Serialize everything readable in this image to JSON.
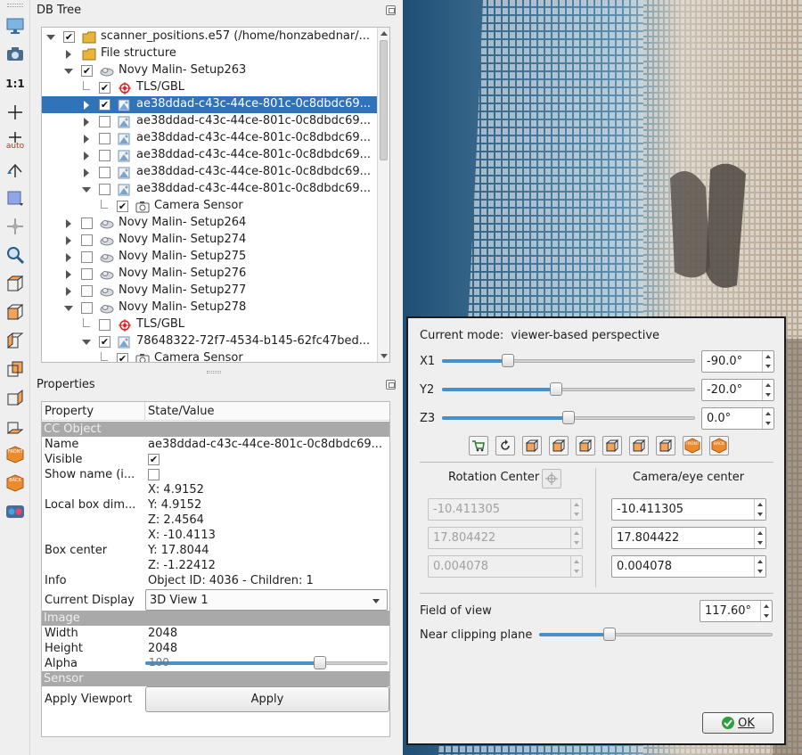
{
  "toolbar": {
    "icons": [
      "display-icon",
      "camera-icon",
      "one-to-one-icon",
      "pivot-icon",
      "auto-pivot-icon",
      "rotate-icon",
      "perspective-icon",
      "translate-icon",
      "zoom-icon",
      "view-top-icon",
      "view-front-icon",
      "view-left-icon",
      "view-back-icon",
      "view-right-icon",
      "view-bottom-icon",
      "view-front-iso-icon",
      "view-back-iso-icon",
      "stereo-glasses-icon"
    ],
    "ratio_label": "1:1",
    "auto_label": "auto",
    "front_label": "FRONT",
    "back_label": "BACK"
  },
  "db_tree": {
    "title": "DB Tree",
    "rows": [
      {
        "label": "scanner_positions.e57 (/home/honzabednar/...",
        "checked": true,
        "expander": "down",
        "icon": "folder-icon"
      },
      {
        "label": "File structure",
        "checked": null,
        "expander": "right",
        "icon": "folder-icon"
      },
      {
        "label": "Novy Malin- Setup263",
        "checked": true,
        "expander": "down",
        "icon": "cloud-icon"
      },
      {
        "label": "TLS/GBL",
        "checked": true,
        "expander": "none",
        "icon": "target-icon"
      },
      {
        "label": "ae38ddad-c43c-44ce-801c-0c8dbdc69...",
        "checked": true,
        "expander": "right",
        "icon": "image-icon",
        "selected": true
      },
      {
        "label": "ae38ddad-c43c-44ce-801c-0c8dbdc69...",
        "checked": false,
        "expander": "right",
        "icon": "image-icon"
      },
      {
        "label": "ae38ddad-c43c-44ce-801c-0c8dbdc69...",
        "checked": false,
        "expander": "right",
        "icon": "image-icon"
      },
      {
        "label": "ae38ddad-c43c-44ce-801c-0c8dbdc69...",
        "checked": false,
        "expander": "right",
        "icon": "image-icon"
      },
      {
        "label": "ae38ddad-c43c-44ce-801c-0c8dbdc69...",
        "checked": false,
        "expander": "right",
        "icon": "image-icon"
      },
      {
        "label": "ae38ddad-c43c-44ce-801c-0c8dbdc69...",
        "checked": false,
        "expander": "down",
        "icon": "image-icon"
      },
      {
        "label": "Camera Sensor",
        "checked": true,
        "expander": "none",
        "icon": "camera-sensor-icon"
      },
      {
        "label": "Novy Malin- Setup264",
        "checked": false,
        "expander": "right",
        "icon": "cloud-icon"
      },
      {
        "label": "Novy Malin- Setup274",
        "checked": false,
        "expander": "right",
        "icon": "cloud-icon"
      },
      {
        "label": "Novy Malin- Setup275",
        "checked": false,
        "expander": "right",
        "icon": "cloud-icon"
      },
      {
        "label": "Novy Malin- Setup276",
        "checked": false,
        "expander": "right",
        "icon": "cloud-icon"
      },
      {
        "label": "Novy Malin- Setup277",
        "checked": false,
        "expander": "right",
        "icon": "cloud-icon"
      },
      {
        "label": "Novy Malin- Setup278",
        "checked": false,
        "expander": "down",
        "icon": "cloud-icon"
      },
      {
        "label": "TLS/GBL",
        "checked": false,
        "expander": "none",
        "icon": "target-icon"
      },
      {
        "label": "78648322-72f7-4534-b145-62fc47bed...",
        "checked": true,
        "expander": "down",
        "icon": "image-icon"
      },
      {
        "label": "Camera Sensor",
        "checked": true,
        "expander": "none",
        "icon": "camera-sensor-icon"
      }
    ]
  },
  "properties": {
    "title": "Properties",
    "col_property": "Property",
    "col_value": "State/Value",
    "section_cc": "CC Object",
    "name_key": "Name",
    "name_val": "ae38ddad-c43c-44ce-801c-0c8dbdc69...",
    "visible_key": "Visible",
    "visible_checked": true,
    "showname_key": "Show name (i...",
    "showname_checked": false,
    "localbox_key": "Local box dim...",
    "localbox_x": "X: 4.9152",
    "localbox_y": "Y: 4.9152",
    "localbox_z": "Z: 2.4564",
    "boxcenter_key": "Box center",
    "boxcenter_x": "X: -10.4113",
    "boxcenter_y": "Y: 17.8044",
    "boxcenter_z": "Z: -1.22412",
    "info_key": "Info",
    "info_val": "Object ID: 4036 - Children: 1",
    "display_key": "Current Display",
    "display_val": "3D View 1",
    "section_image": "Image",
    "width_key": "Width",
    "width_val": "2048",
    "height_key": "Height",
    "height_val": "2048",
    "alpha_key": "Alpha",
    "alpha_val": "100",
    "alpha_fraction": 0.72,
    "section_sensor": "Sensor",
    "viewport_key": "Apply Viewport",
    "apply_label": "Apply"
  },
  "dialog": {
    "mode_label": "Current mode:",
    "mode_value": "viewer-based perspective",
    "x1_label": "X1",
    "x1_value": "-90.0°",
    "x1_fraction": 0.26,
    "y2_label": "Y2",
    "y2_value": "-20.0°",
    "y2_fraction": 0.45,
    "z3_label": "Z3",
    "z3_value": "0.0°",
    "z3_fraction": 0.5,
    "view_buttons": [
      "cart-icon",
      "reset-icon",
      "view-top-icon",
      "view-front-icon",
      "view-left-icon",
      "view-back-icon",
      "view-right-icon",
      "view-bottom-icon",
      "view-front-iso-icon",
      "view-back-iso-icon"
    ],
    "front_label": "FRONT",
    "back_label": "BACK",
    "rotation_center_label": "Rotation Center",
    "camera_center_label": "Camera/eye center",
    "rc_x": "-10.411305",
    "rc_y": "17.804422",
    "rc_z": "0.004078",
    "cam_x": "-10.411305",
    "cam_y": "17.804422",
    "cam_z": "0.004078",
    "fov_label": "Field of view",
    "fov_value": "117.60°",
    "near_label": "Near clipping plane",
    "near_fraction": 0.3,
    "ok_label": "OK"
  }
}
